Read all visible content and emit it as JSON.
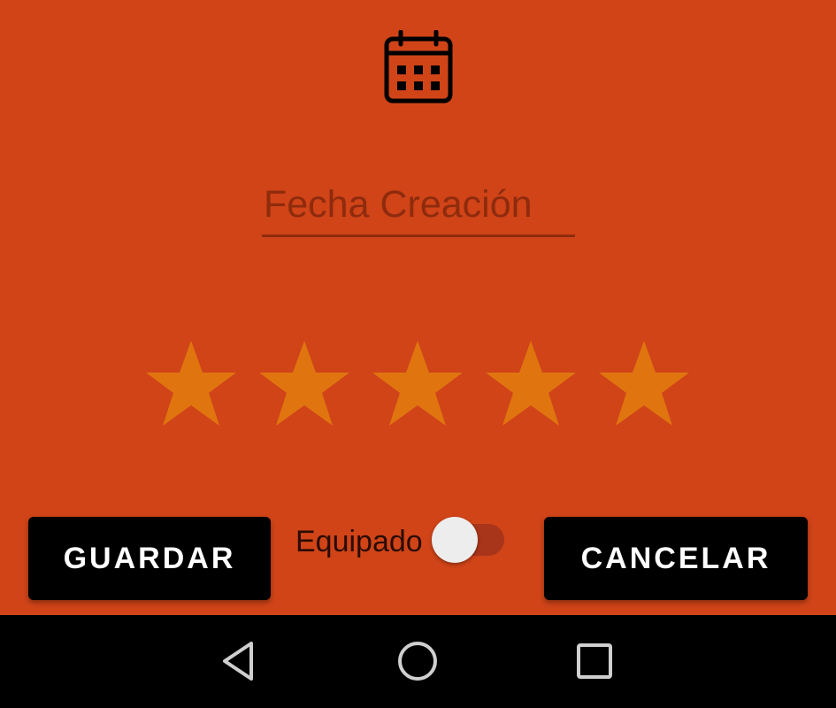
{
  "form": {
    "calendar_icon": "calendar-icon",
    "date_placeholder": "Fecha Creación",
    "rating": {
      "max": 5,
      "value": 5,
      "icon": "star-icon",
      "color": "#E07510"
    },
    "switch": {
      "label": "Equipado",
      "checked": false
    }
  },
  "buttons": {
    "save_label": "GUARDAR",
    "cancel_label": "CANCELAR"
  },
  "navbar": {
    "back_icon": "back-triangle-icon",
    "home_icon": "home-circle-icon",
    "recent_icon": "recent-square-icon"
  },
  "colors": {
    "background": "#D04418",
    "accent": "#8E2B0D",
    "button": "#000000",
    "button_text": "#FFFFFF"
  }
}
